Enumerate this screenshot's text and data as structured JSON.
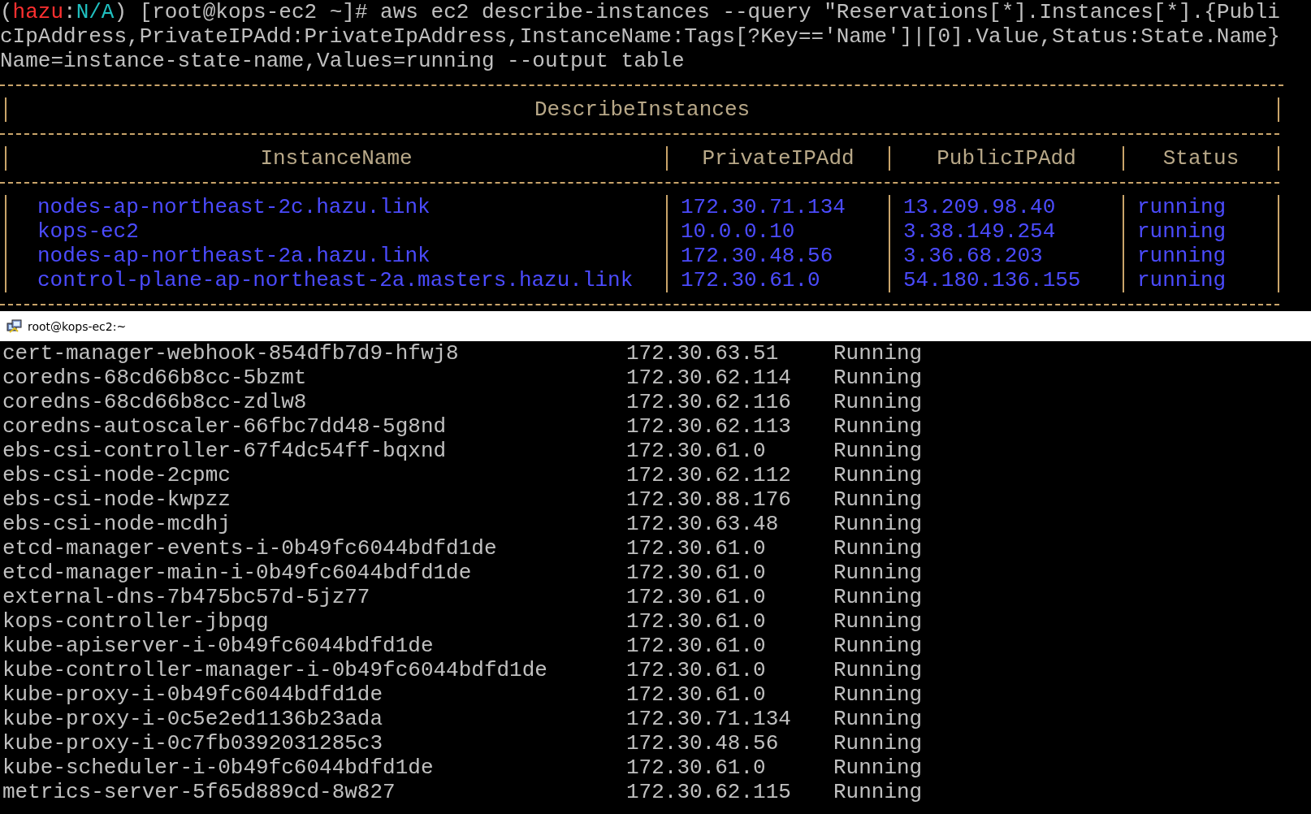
{
  "top_terminal": {
    "prompt": {
      "open": "(",
      "user": "hazu",
      "sep": ":",
      "context": "N/A",
      "close": ")",
      "rest": " [root@kops-ec2 ~]#"
    },
    "command_lines": [
      " aws ec2 describe-instances --query \"Reservations[*].Instances[*].{Publi",
      "cIpAddress,PrivateIPAdd:PrivateIpAddress,InstanceName:Tags[?Key=='Name']|[0].Value,Status:State.Name}",
      "Name=instance-state-name,Values=running --output table"
    ],
    "table": {
      "title": "DescribeInstances",
      "columns": [
        "InstanceName",
        "PrivateIPAdd",
        "PublicIPAdd",
        "Status"
      ],
      "rows": [
        [
          "nodes-ap-northeast-2c.hazu.link",
          "172.30.71.134",
          "13.209.98.40",
          "running"
        ],
        [
          "kops-ec2",
          "10.0.0.10",
          "3.38.149.254",
          "running"
        ],
        [
          "nodes-ap-northeast-2a.hazu.link",
          "172.30.48.56",
          "3.36.68.203",
          "running"
        ],
        [
          "control-plane-ap-northeast-2a.masters.hazu.link",
          "172.30.61.0",
          "54.180.136.155",
          "running"
        ]
      ]
    }
  },
  "bottom_terminal": {
    "title": "root@kops-ec2:~",
    "rows": [
      [
        "cert-manager-webhook-854dfb7d9-hfwj8",
        "172.30.63.51",
        "Running"
      ],
      [
        "coredns-68cd66b8cc-5bzmt",
        "172.30.62.114",
        "Running"
      ],
      [
        "coredns-68cd66b8cc-zdlw8",
        "172.30.62.116",
        "Running"
      ],
      [
        "coredns-autoscaler-66fbc7dd48-5g8nd",
        "172.30.62.113",
        "Running"
      ],
      [
        "ebs-csi-controller-67f4dc54ff-bqxnd",
        "172.30.61.0",
        "Running"
      ],
      [
        "ebs-csi-node-2cpmc",
        "172.30.62.112",
        "Running"
      ],
      [
        "ebs-csi-node-kwpzz",
        "172.30.88.176",
        "Running"
      ],
      [
        "ebs-csi-node-mcdhj",
        "172.30.63.48",
        "Running"
      ],
      [
        "etcd-manager-events-i-0b49fc6044bdfd1de",
        "172.30.61.0",
        "Running"
      ],
      [
        "etcd-manager-main-i-0b49fc6044bdfd1de",
        "172.30.61.0",
        "Running"
      ],
      [
        "external-dns-7b475bc57d-5jz77",
        "172.30.61.0",
        "Running"
      ],
      [
        "kops-controller-jbpqg",
        "172.30.61.0",
        "Running"
      ],
      [
        "kube-apiserver-i-0b49fc6044bdfd1de",
        "172.30.61.0",
        "Running"
      ],
      [
        "kube-controller-manager-i-0b49fc6044bdfd1de",
        "172.30.61.0",
        "Running"
      ],
      [
        "kube-proxy-i-0b49fc6044bdfd1de",
        "172.30.61.0",
        "Running"
      ],
      [
        "kube-proxy-i-0c5e2ed1136b23ada",
        "172.30.71.134",
        "Running"
      ],
      [
        "kube-proxy-i-0c7fb0392031285c3",
        "172.30.48.56",
        "Running"
      ],
      [
        "kube-scheduler-i-0b49fc6044bdfd1de",
        "172.30.61.0",
        "Running"
      ],
      [
        "metrics-server-5f65d889cd-8w827",
        "172.30.62.115",
        "Running"
      ]
    ]
  }
}
